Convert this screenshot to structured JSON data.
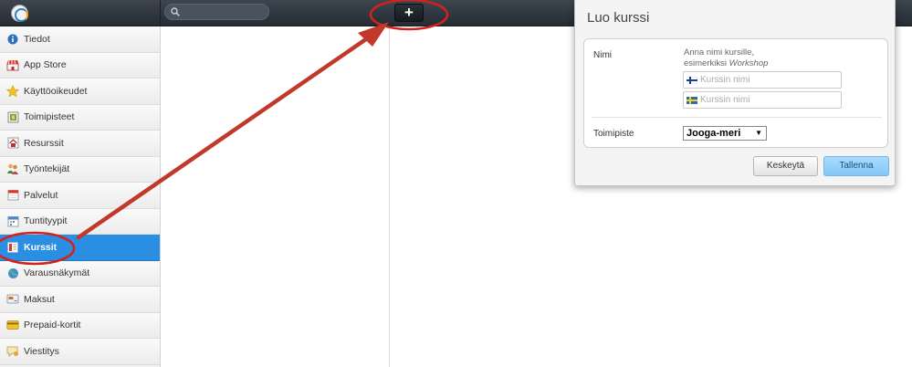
{
  "search": {
    "placeholder": ""
  },
  "toolbar": {
    "add_label": "+"
  },
  "sidebar": {
    "items": [
      {
        "label": "Tiedot",
        "icon": "info-icon",
        "active": false
      },
      {
        "label": "App Store",
        "icon": "store-icon",
        "active": false
      },
      {
        "label": "Käyttöoikeudet",
        "icon": "star-icon",
        "active": false
      },
      {
        "label": "Toimipisteet",
        "icon": "location-icon",
        "active": false
      },
      {
        "label": "Resurssit",
        "icon": "house-icon",
        "active": false
      },
      {
        "label": "Työntekijät",
        "icon": "people-icon",
        "active": false
      },
      {
        "label": "Palvelut",
        "icon": "calendar-icon",
        "active": false
      },
      {
        "label": "Tuntityypit",
        "icon": "calendar-grid-icon",
        "active": false
      },
      {
        "label": "Kurssit",
        "icon": "course-icon",
        "active": true
      },
      {
        "label": "Varausnäkymät",
        "icon": "globe-icon",
        "active": false
      },
      {
        "label": "Maksut",
        "icon": "payment-icon",
        "active": false
      },
      {
        "label": "Prepaid-kortit",
        "icon": "card-icon",
        "active": false
      },
      {
        "label": "Viestitys",
        "icon": "message-icon",
        "active": false
      }
    ]
  },
  "dialog": {
    "title": "Luo kurssi",
    "name_label": "Nimi",
    "help_line1": "Anna nimi kursille,",
    "help_line2_prefix": "esimerkiksi ",
    "help_line2_example": "Workshop",
    "name_fi_placeholder": "Kurssin nimi",
    "name_sv_placeholder": "Kurssin nimi",
    "location_label": "Toimipiste",
    "location_value": "Jooga-meri",
    "cancel_label": "Keskeytä",
    "save_label": "Tallenna"
  },
  "colors": {
    "active": "#2a8fe3",
    "annotation": "#c0392b",
    "topbar": "#2f353d"
  }
}
